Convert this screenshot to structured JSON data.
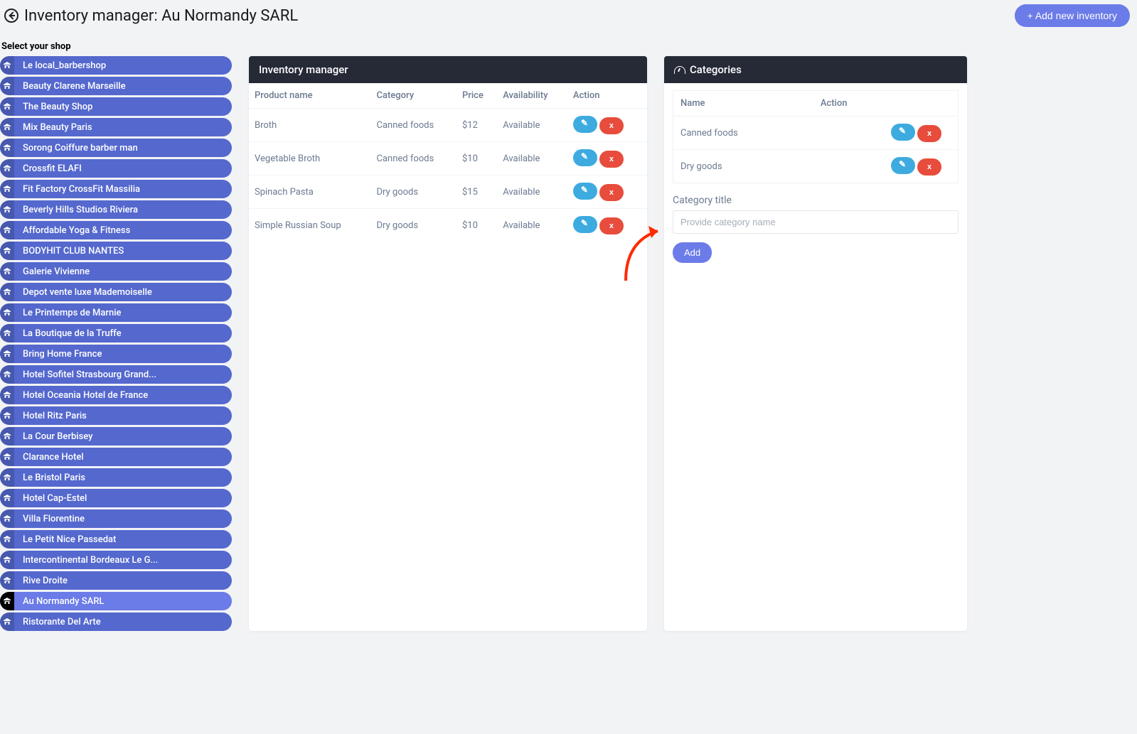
{
  "header": {
    "page_title": "Inventory manager: Au Normandy SARL",
    "add_inventory_label": "+ Add new inventory"
  },
  "shop_section": {
    "label": "Select your shop",
    "shops": [
      {
        "name": "Le local_barbershop",
        "active": false
      },
      {
        "name": "Beauty Clarene Marseille",
        "active": false
      },
      {
        "name": "The Beauty Shop",
        "active": false
      },
      {
        "name": "Mix Beauty Paris",
        "active": false
      },
      {
        "name": "Sorong Coiffure barber man",
        "active": false
      },
      {
        "name": "Crossfit ELAFI",
        "active": false
      },
      {
        "name": "Fit Factory CrossFit Massilia",
        "active": false
      },
      {
        "name": "Beverly Hills Studios Riviera",
        "active": false
      },
      {
        "name": "Affordable Yoga & Fitness",
        "active": false
      },
      {
        "name": "BODYHIT CLUB NANTES",
        "active": false
      },
      {
        "name": "Galerie Vivienne",
        "active": false
      },
      {
        "name": "Depot vente luxe Mademoiselle",
        "active": false
      },
      {
        "name": "Le Printemps de Marnie",
        "active": false
      },
      {
        "name": "La Boutique de la Truffe",
        "active": false
      },
      {
        "name": "Bring Home France",
        "active": false
      },
      {
        "name": "Hotel Sofitel Strasbourg Grand...",
        "active": false
      },
      {
        "name": "Hotel Oceania Hotel de France",
        "active": false
      },
      {
        "name": "Hotel Ritz Paris",
        "active": false
      },
      {
        "name": "La Cour Berbisey",
        "active": false
      },
      {
        "name": "Clarance Hotel",
        "active": false
      },
      {
        "name": "Le Bristol Paris",
        "active": false
      },
      {
        "name": "Hotel Cap-Estel",
        "active": false
      },
      {
        "name": "Villa Florentine",
        "active": false
      },
      {
        "name": "Le Petit Nice Passedat",
        "active": false
      },
      {
        "name": "Intercontinental Bordeaux Le G...",
        "active": false
      },
      {
        "name": "Rive Droite",
        "active": false
      },
      {
        "name": "Au Normandy SARL",
        "active": true
      },
      {
        "name": "Ristorante Del Arte",
        "active": false
      }
    ]
  },
  "inventory": {
    "card_title": "Inventory manager",
    "columns": {
      "product": "Product name",
      "category": "Category",
      "price": "Price",
      "availability": "Availability",
      "action": "Action"
    },
    "rows": [
      {
        "product": "Broth",
        "category": "Canned foods",
        "price": "$12",
        "availability": "Available"
      },
      {
        "product": "Vegetable Broth",
        "category": "Canned foods",
        "price": "$10",
        "availability": "Available"
      },
      {
        "product": "Spinach Pasta",
        "category": "Dry goods",
        "price": "$15",
        "availability": "Available"
      },
      {
        "product": "Simple Russian Soup",
        "category": "Dry goods",
        "price": "$10",
        "availability": "Available"
      }
    ]
  },
  "categories": {
    "card_title": "Categories",
    "columns": {
      "name": "Name",
      "action": "Action"
    },
    "rows": [
      {
        "name": "Canned foods"
      },
      {
        "name": "Dry goods"
      }
    ],
    "form": {
      "title_label": "Category title",
      "placeholder": "Provide category name",
      "add_label": "Add"
    }
  }
}
